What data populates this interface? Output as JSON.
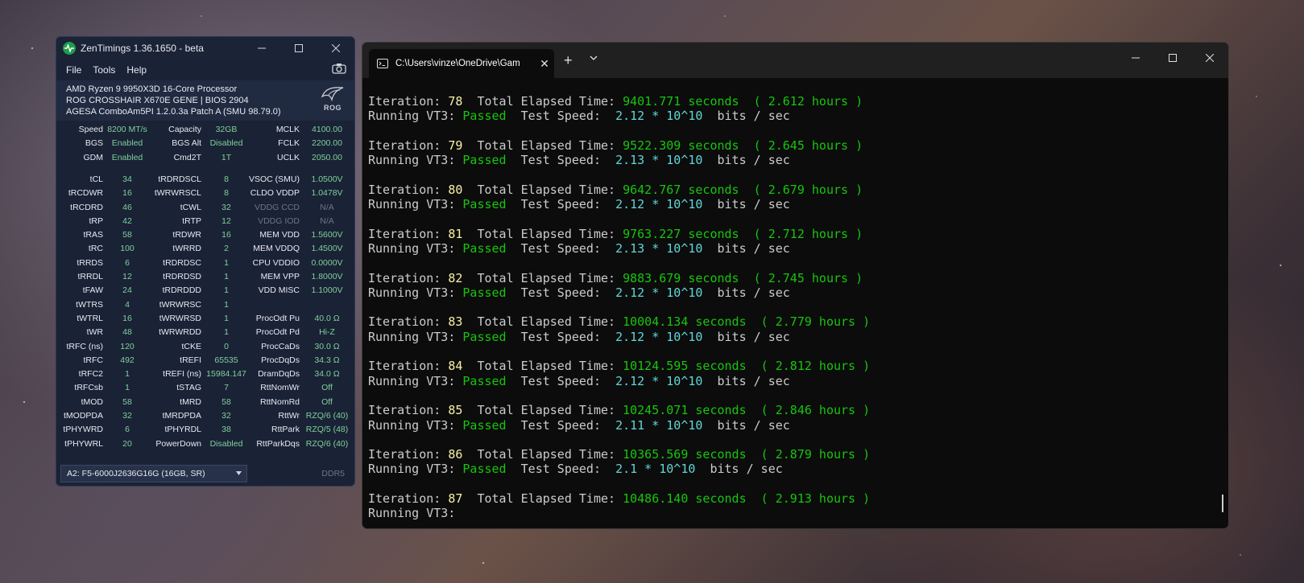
{
  "zentimings": {
    "title": "ZenTimings 1.36.1650 - beta",
    "menu": [
      "File",
      "Tools",
      "Help"
    ],
    "system": {
      "cpu": "AMD Ryzen 9 9950X3D 16-Core Processor",
      "board": "ROG CROSSHAIR X670E GENE | BIOS 2904",
      "agesa": "AGESA ComboAm5PI 1.2.0.3a Patch A (SMU 98.79.0)",
      "brand": "ROG"
    },
    "rows": [
      [
        [
          "Speed",
          "8200 MT/s"
        ],
        [
          "Capacity",
          "32GB"
        ],
        [
          "MCLK",
          "4100.00"
        ]
      ],
      [
        [
          "BGS",
          "Enabled"
        ],
        [
          "BGS Alt",
          "Disabled"
        ],
        [
          "FCLK",
          "2200.00"
        ]
      ],
      [
        [
          "GDM",
          "Enabled"
        ],
        [
          "Cmd2T",
          "1T"
        ],
        [
          "UCLK",
          "2050.00"
        ]
      ],
      [
        [
          "tCL",
          "34"
        ],
        [
          "tRDRDSCL",
          "8"
        ],
        [
          "VSOC (SMU)",
          "1.0500V"
        ]
      ],
      [
        [
          "tRCDWR",
          "16"
        ],
        [
          "tWRWRSCL",
          "8"
        ],
        [
          "CLDO VDDP",
          "1.0478V"
        ]
      ],
      [
        [
          "tRCDRD",
          "46"
        ],
        [
          "tCWL",
          "32"
        ],
        [
          "VDDG CCD",
          "N/A"
        ]
      ],
      [
        [
          "tRP",
          "42"
        ],
        [
          "tRTP",
          "12"
        ],
        [
          "VDDG IOD",
          "N/A"
        ]
      ],
      [
        [
          "tRAS",
          "58"
        ],
        [
          "tRDWR",
          "16"
        ],
        [
          "MEM VDD",
          "1.5600V"
        ]
      ],
      [
        [
          "tRC",
          "100"
        ],
        [
          "tWRRD",
          "2"
        ],
        [
          "MEM VDDQ",
          "1.4500V"
        ]
      ],
      [
        [
          "tRRDS",
          "6"
        ],
        [
          "tRDRDSC",
          "1"
        ],
        [
          "CPU VDDIO",
          "0.0000V"
        ]
      ],
      [
        [
          "tRRDL",
          "12"
        ],
        [
          "tRDRDSD",
          "1"
        ],
        [
          "MEM VPP",
          "1.8000V"
        ]
      ],
      [
        [
          "tFAW",
          "24"
        ],
        [
          "tRDRDDD",
          "1"
        ],
        [
          "VDD MISC",
          "1.1000V"
        ]
      ],
      [
        [
          "tWTRS",
          "4"
        ],
        [
          "tWRWRSC",
          "1"
        ],
        [
          "",
          ""
        ]
      ],
      [
        [
          "tWTRL",
          "16"
        ],
        [
          "tWRWRSD",
          "1"
        ],
        [
          "ProcOdt Pu",
          "40.0 Ω"
        ]
      ],
      [
        [
          "tWR",
          "48"
        ],
        [
          "tWRWRDD",
          "1"
        ],
        [
          "ProcOdt Pd",
          "Hi-Z"
        ]
      ],
      [
        [
          "tRFC (ns)",
          "120"
        ],
        [
          "tCKE",
          "0"
        ],
        [
          "ProcCaDs",
          "30.0 Ω"
        ]
      ],
      [
        [
          "tRFC",
          "492"
        ],
        [
          "tREFI",
          "65535"
        ],
        [
          "ProcDqDs",
          "34.3 Ω"
        ]
      ],
      [
        [
          "tRFC2",
          "1"
        ],
        [
          "tREFI (ns)",
          "15984.147"
        ],
        [
          "DramDqDs",
          "34.0 Ω"
        ]
      ],
      [
        [
          "tRFCsb",
          "1"
        ],
        [
          "tSTAG",
          "7"
        ],
        [
          "RttNomWr",
          "Off"
        ]
      ],
      [
        [
          "tMOD",
          "58"
        ],
        [
          "tMRD",
          "58"
        ],
        [
          "RttNomRd",
          "Off"
        ]
      ],
      [
        [
          "tMODPDA",
          "32"
        ],
        [
          "tMRDPDA",
          "32"
        ],
        [
          "RttWr",
          "RZQ/6 (40)"
        ]
      ],
      [
        [
          "tPHYWRD",
          "6"
        ],
        [
          "tPHYRDL",
          "38"
        ],
        [
          "RttPark",
          "RZQ/5 (48)"
        ]
      ],
      [
        [
          "tPHYWRL",
          "20"
        ],
        [
          "PowerDown",
          "Disabled"
        ],
        [
          "RttParkDqs",
          "RZQ/6 (40)"
        ]
      ]
    ],
    "dimm_select": "A2: F5-6000J2636G16G (16GB, SR)",
    "mem_type": "DDR5"
  },
  "terminal": {
    "tab_title": "C:\\Users\\vinze\\OneDrive\\Gam",
    "labels": {
      "iteration": "Iteration: ",
      "elapsed": "  Total Elapsed Time: ",
      "running": "Running VT3: ",
      "passed": "Passed",
      "speed": "  Test Speed:  ",
      "bits": "  bits / sec"
    },
    "iterations": [
      {
        "n": "78",
        "seconds": "9401.771 seconds",
        "hours": "  ( 2.612 hours )",
        "status": "Passed",
        "speed": "2.12 * 10^10"
      },
      {
        "n": "79",
        "seconds": "9522.309 seconds",
        "hours": "  ( 2.645 hours )",
        "status": "Passed",
        "speed": "2.13 * 10^10"
      },
      {
        "n": "80",
        "seconds": "9642.767 seconds",
        "hours": "  ( 2.679 hours )",
        "status": "Passed",
        "speed": "2.12 * 10^10"
      },
      {
        "n": "81",
        "seconds": "9763.227 seconds",
        "hours": "  ( 2.712 hours )",
        "status": "Passed",
        "speed": "2.13 * 10^10"
      },
      {
        "n": "82",
        "seconds": "9883.679 seconds",
        "hours": "  ( 2.745 hours )",
        "status": "Passed",
        "speed": "2.12 * 10^10"
      },
      {
        "n": "83",
        "seconds": "10004.134 seconds",
        "hours": "  ( 2.779 hours )",
        "status": "Passed",
        "speed": "2.12 * 10^10"
      },
      {
        "n": "84",
        "seconds": "10124.595 seconds",
        "hours": "  ( 2.812 hours )",
        "status": "Passed",
        "speed": "2.12 * 10^10"
      },
      {
        "n": "85",
        "seconds": "10245.071 seconds",
        "hours": "  ( 2.846 hours )",
        "status": "Passed",
        "speed": "2.11 * 10^10"
      },
      {
        "n": "86",
        "seconds": "10365.569 seconds",
        "hours": "  ( 2.879 hours )",
        "status": "Passed",
        "speed": "2.1 * 10^10"
      },
      {
        "n": "87",
        "seconds": "10486.140 seconds",
        "hours": "  ( 2.913 hours )",
        "status": "",
        "speed": ""
      }
    ]
  },
  "colors": {
    "zt_bg": "#1a2236",
    "zt_value": "#7fd19a",
    "term_bg": "#0c0c0c",
    "term_yellow": "#f9f1a5",
    "term_green": "#16c60c",
    "term_cyan": "#61d6d6"
  },
  "icons": [
    "zentimings-logo-icon",
    "minimize-icon",
    "maximize-icon",
    "close-icon",
    "camera-icon",
    "rog-logo-icon",
    "chevron-down-icon",
    "terminal-icon",
    "plus-icon"
  ]
}
